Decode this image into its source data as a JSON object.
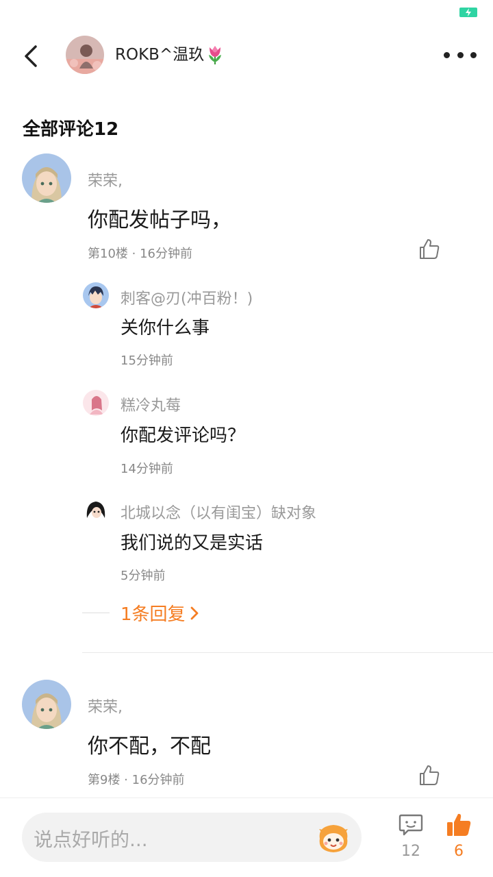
{
  "header": {
    "name": "ROKB^温玖"
  },
  "section_title": "全部评论12",
  "comments": [
    {
      "author": "荣荣,",
      "content": "你配发帖子吗，",
      "meta": "第10楼 · 16分钟前",
      "replies": [
        {
          "author": "刺客@刃(冲百粉！)",
          "content": "关你什么事",
          "time": "15分钟前"
        },
        {
          "author": "糕冷丸莓",
          "content": "你配发评论吗？",
          "time": "14分钟前"
        },
        {
          "author": "北城以念（以有闺宝）缺对象",
          "content": "我们说的又是实话",
          "time": "5分钟前"
        }
      ],
      "more_replies": "1条回复"
    },
    {
      "author": "荣荣,",
      "content": "你不配，不配",
      "meta": "第9楼 · 16分钟前"
    }
  ],
  "bottom": {
    "placeholder": "说点好听的...",
    "comment_count": "12",
    "like_count": "6"
  },
  "colors": {
    "accent": "#f57d22",
    "battery": "#2fd4a3"
  }
}
